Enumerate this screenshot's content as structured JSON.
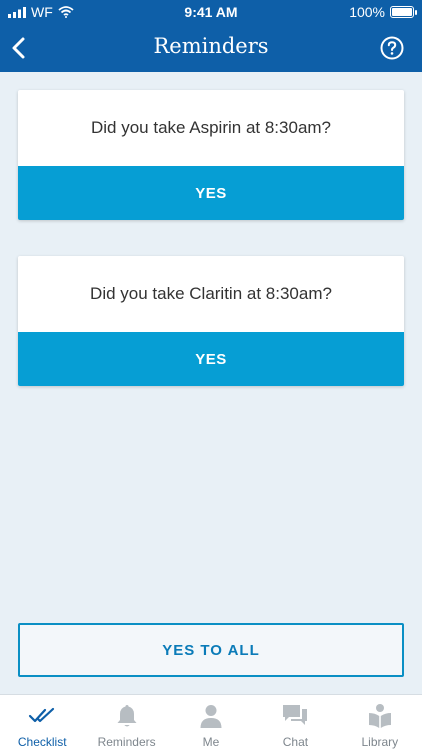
{
  "status_bar": {
    "carrier": "WF",
    "time": "9:41 AM",
    "battery": "100%"
  },
  "nav": {
    "title": "Reminders",
    "back_icon": "chevron-left-icon",
    "help_icon": "question-circle-icon"
  },
  "reminders": [
    {
      "question": "Did you take Aspirin at 8:30am?",
      "yes_label": "YES"
    },
    {
      "question": "Did you take Claritin at 8:30am?",
      "yes_label": "YES"
    }
  ],
  "yes_to_all_label": "YES TO ALL",
  "tabs": [
    {
      "label": "Checklist",
      "icon": "double-check-icon",
      "active": true
    },
    {
      "label": "Reminders",
      "icon": "bell-icon",
      "active": false
    },
    {
      "label": "Me",
      "icon": "person-icon",
      "active": false
    },
    {
      "label": "Chat",
      "icon": "chat-bubbles-icon",
      "active": false
    },
    {
      "label": "Library",
      "icon": "book-icon",
      "active": false
    }
  ],
  "colors": {
    "header": "#0e5fa8",
    "accent": "#069ed4",
    "background": "#e8f0f6",
    "tab_active": "#0e5fa8",
    "tab_inactive": "#7e868d"
  }
}
